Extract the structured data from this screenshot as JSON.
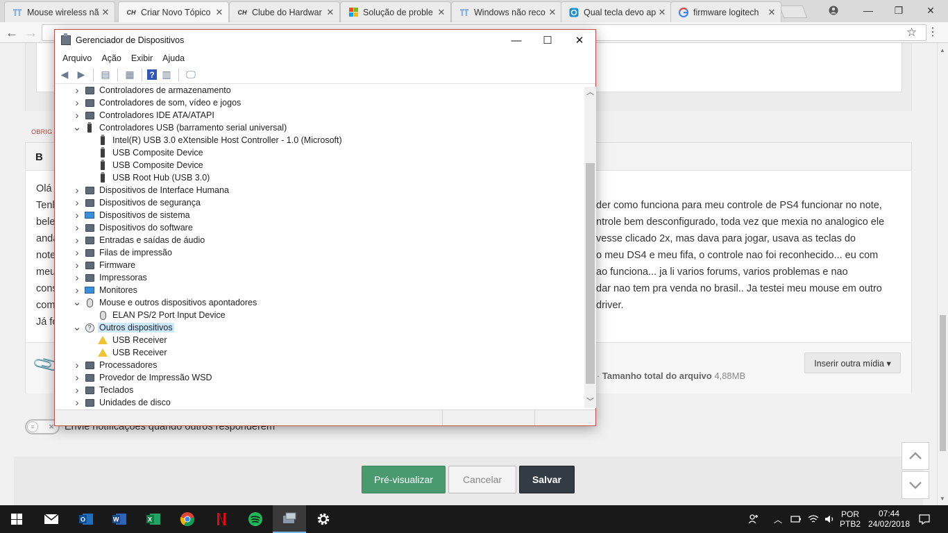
{
  "browser": {
    "tabs": [
      {
        "title": "Mouse wireless nã",
        "icon": "tt",
        "color": "#7aa7d8"
      },
      {
        "title": "Criar Novo Tópico",
        "icon": "CH",
        "color": "#333333"
      },
      {
        "title": "Clube do Hardwar",
        "icon": "CH",
        "color": "#333333"
      },
      {
        "title": "Solução de proble",
        "icon": "ms",
        "color": "#f25022"
      },
      {
        "title": "Windows não reco",
        "icon": "tt",
        "color": "#7aa7d8"
      },
      {
        "title": "Qual tecla devo ap",
        "icon": "q",
        "color": "#1a8fd1"
      },
      {
        "title": "firmware logitech",
        "icon": "G",
        "color": "#4285f4"
      }
    ],
    "active_tab": 1
  },
  "page": {
    "required_label": "OBRIG",
    "editor_toolbar_bold": "B",
    "editor_lines": [
      {
        "left": "Olá",
        "right": ""
      },
      {
        "left": "Tenl",
        "right": "der como funciona para meu controle de PS4 funcionar no note,"
      },
      {
        "left": "bele",
        "right": "ntrole bem desconfigurado, toda vez que mexia no analogico ele"
      },
      {
        "left": "anda",
        "right": "vesse clicado 2x, mas dava para jogar, usava as teclas do"
      },
      {
        "left": "note",
        "right": "o meu DS4 e meu fifa, o controle nao foi reconhecido... eu com"
      },
      {
        "left": "meu",
        "right": "ao funciona... ja li varios forums, varios problemas e nao"
      },
      {
        "left": "cons",
        "right": "dar nao tem pra venda no brasil.. Ja testei meu mouse em outro"
      },
      {
        "left": "com",
        "right": "driver."
      },
      {
        "left": "Já fo",
        "right": ""
      }
    ],
    "attachment_info_prefix": "g ·",
    "attachment_total_label": "Tamanho total do arquivo",
    "attachment_total_value": "4,88MB",
    "insert_media_label": "Inserir outra mídia ▾",
    "notify_label": "Envie notificações quando outros responderem",
    "buttons": {
      "preview": "Pré-visualizar",
      "cancel": "Cancelar",
      "save": "Salvar"
    }
  },
  "device_manager": {
    "title": "Gerenciador de Dispositivos",
    "menu": [
      "Arquivo",
      "Ação",
      "Exibir",
      "Ajuda"
    ],
    "tree": [
      {
        "label": "Controladores de armazenamento",
        "level": 0,
        "expand": ">",
        "icon": "gen"
      },
      {
        "label": "Controladores de som, vídeo e jogos",
        "level": 0,
        "expand": ">",
        "icon": "gen"
      },
      {
        "label": "Controladores IDE ATA/ATAPI",
        "level": 0,
        "expand": ">",
        "icon": "gen"
      },
      {
        "label": "Controladores USB (barramento serial universal)",
        "level": 0,
        "expand": "v",
        "icon": "usb"
      },
      {
        "label": "Intel(R) USB 3.0 eXtensible Host Controller - 1.0 (Microsoft)",
        "level": 1,
        "expand": "",
        "icon": "usb"
      },
      {
        "label": "USB Composite Device",
        "level": 1,
        "expand": "",
        "icon": "usb"
      },
      {
        "label": "USB Composite Device",
        "level": 1,
        "expand": "",
        "icon": "usb"
      },
      {
        "label": "USB Root Hub (USB 3.0)",
        "level": 1,
        "expand": "",
        "icon": "usb"
      },
      {
        "label": "Dispositivos de Interface Humana",
        "level": 0,
        "expand": ">",
        "icon": "gen"
      },
      {
        "label": "Dispositivos de segurança",
        "level": 0,
        "expand": ">",
        "icon": "gen"
      },
      {
        "label": "Dispositivos de sistema",
        "level": 0,
        "expand": ">",
        "icon": "mon"
      },
      {
        "label": "Dispositivos do software",
        "level": 0,
        "expand": ">",
        "icon": "gen"
      },
      {
        "label": "Entradas e saídas de áudio",
        "level": 0,
        "expand": ">",
        "icon": "gen"
      },
      {
        "label": "Filas de impressão",
        "level": 0,
        "expand": ">",
        "icon": "gen"
      },
      {
        "label": "Firmware",
        "level": 0,
        "expand": ">",
        "icon": "gen"
      },
      {
        "label": "Impressoras",
        "level": 0,
        "expand": ">",
        "icon": "gen"
      },
      {
        "label": "Monitores",
        "level": 0,
        "expand": ">",
        "icon": "mon"
      },
      {
        "label": "Mouse e outros dispositivos apontadores",
        "level": 0,
        "expand": "v",
        "icon": "mouse"
      },
      {
        "label": "ELAN PS/2 Port Input Device",
        "level": 1,
        "expand": "",
        "icon": "mouse"
      },
      {
        "label": "Outros dispositivos",
        "level": 0,
        "expand": "v",
        "icon": "q",
        "selected": true
      },
      {
        "label": "USB Receiver",
        "level": 1,
        "expand": "",
        "icon": "warn"
      },
      {
        "label": "USB Receiver",
        "level": 1,
        "expand": "",
        "icon": "warn"
      },
      {
        "label": "Processadores",
        "level": 0,
        "expand": ">",
        "icon": "gen"
      },
      {
        "label": "Provedor de Impressão WSD",
        "level": 0,
        "expand": ">",
        "icon": "gen"
      },
      {
        "label": "Teclados",
        "level": 0,
        "expand": ">",
        "icon": "gen"
      },
      {
        "label": "Unidades de disco",
        "level": 0,
        "expand": ">",
        "icon": "gen"
      }
    ]
  },
  "taskbar": {
    "lang_top": "POR",
    "lang_bottom": "PTB2",
    "time": "07:44",
    "date": "24/02/2018"
  }
}
